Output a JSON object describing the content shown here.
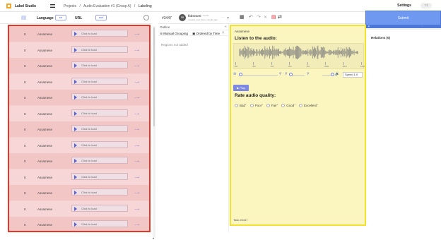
{
  "app": {
    "name": "Label Studio"
  },
  "breadcrumb": [
    "Projects",
    "/",
    "Audio Evaluation #1 (Group A)",
    "/",
    "Labeling"
  ],
  "header": {
    "settings_label": "Settings",
    "user_initials": "TT"
  },
  "table": {
    "columns": {
      "language": "Language",
      "language_type": "str",
      "url": "URL",
      "url_type": "aud"
    },
    "rows": [
      {
        "id": "0",
        "language": "Assamese",
        "audio": "Click to load"
      },
      {
        "id": "0",
        "language": "Assamese",
        "audio": "Click to load"
      },
      {
        "id": "0",
        "language": "Assamese",
        "audio": "Click to load"
      },
      {
        "id": "0",
        "language": "Assamese",
        "audio": "Click to load"
      },
      {
        "id": "0",
        "language": "Assamese",
        "audio": "Click to load"
      },
      {
        "id": "0",
        "language": "Assamese",
        "audio": "Click to load"
      },
      {
        "id": "0",
        "language": "Assamese",
        "audio": "Click to load"
      },
      {
        "id": "0",
        "language": "Assamese",
        "audio": "Click to load"
      },
      {
        "id": "0",
        "language": "Assamese",
        "audio": "Click to load"
      },
      {
        "id": "0",
        "language": "Assamese",
        "audio": "Click to load"
      },
      {
        "id": "0",
        "language": "Assamese",
        "audio": "Click to load"
      },
      {
        "id": "0",
        "language": "Assamese",
        "audio": "Click to load"
      },
      {
        "id": "0",
        "language": "Assamese",
        "audio": "Click to load"
      }
    ]
  },
  "annotation": {
    "task_id": "#3447",
    "user": "fbbsean0",
    "avatar_initials": "FB",
    "meta": "created, less than a minute ago",
    "extra": "Ann#1"
  },
  "toolbar": {
    "submit_label": "Submit"
  },
  "outline": {
    "title": "Outline",
    "manual_grouping": "Manual Grouping",
    "ordered_by": "Ordered by Time",
    "empty": "Regions not added"
  },
  "audio": {
    "language": "Assamese",
    "title": "Listen to the audio:",
    "ticks": [
      "0.0",
      "2.0",
      "4.0",
      "6.0",
      "8.0",
      "10.0",
      "12.0",
      "14.0"
    ],
    "speed": "Speed 1.0",
    "play_label": "Play"
  },
  "rating": {
    "title": "Rate audio quality:",
    "choices": [
      {
        "label": "Bad",
        "hotkey": "1"
      },
      {
        "label": "Poor",
        "hotkey": "2"
      },
      {
        "label": "Fair",
        "hotkey": "3"
      },
      {
        "label": "Good",
        "hotkey": "4"
      },
      {
        "label": "Excellent",
        "hotkey": "5"
      }
    ]
  },
  "task_footer": "Task #3447",
  "relations": {
    "title": "Relations (0)"
  },
  "colors": {
    "accent": "#6f98f0",
    "highlight_red": "#e0392b",
    "highlight_yellow": "#f2e22e"
  }
}
